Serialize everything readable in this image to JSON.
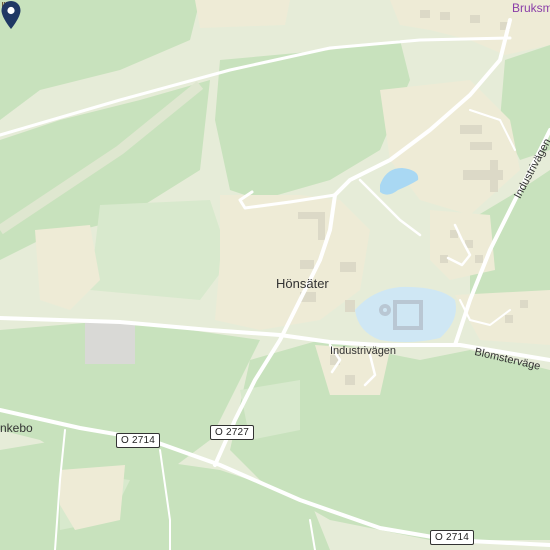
{
  "map": {
    "colors": {
      "forest": "#c9e3c0",
      "open_land": "#e8edda",
      "urban": "#efeddb",
      "water": "#a9d8f3",
      "road": "#ffffff",
      "pin": "#1f3864"
    },
    "place_labels": {
      "main": "Hönsäter",
      "bottom_left": "nkebo",
      "top_right": "Bruksm"
    },
    "road_labels": {
      "industrivagen": "Industrivägen",
      "blomstervagen": "Blomstervägе",
      "industrivagen_vertical": "Industrivägen"
    },
    "road_shields": {
      "o2714_left": "O 2714",
      "o2727": "O 2727",
      "o2714_bottom": "O 2714"
    },
    "icons": {
      "marker": "location-pin-icon",
      "restaurant": "fork-knife-icon"
    }
  }
}
